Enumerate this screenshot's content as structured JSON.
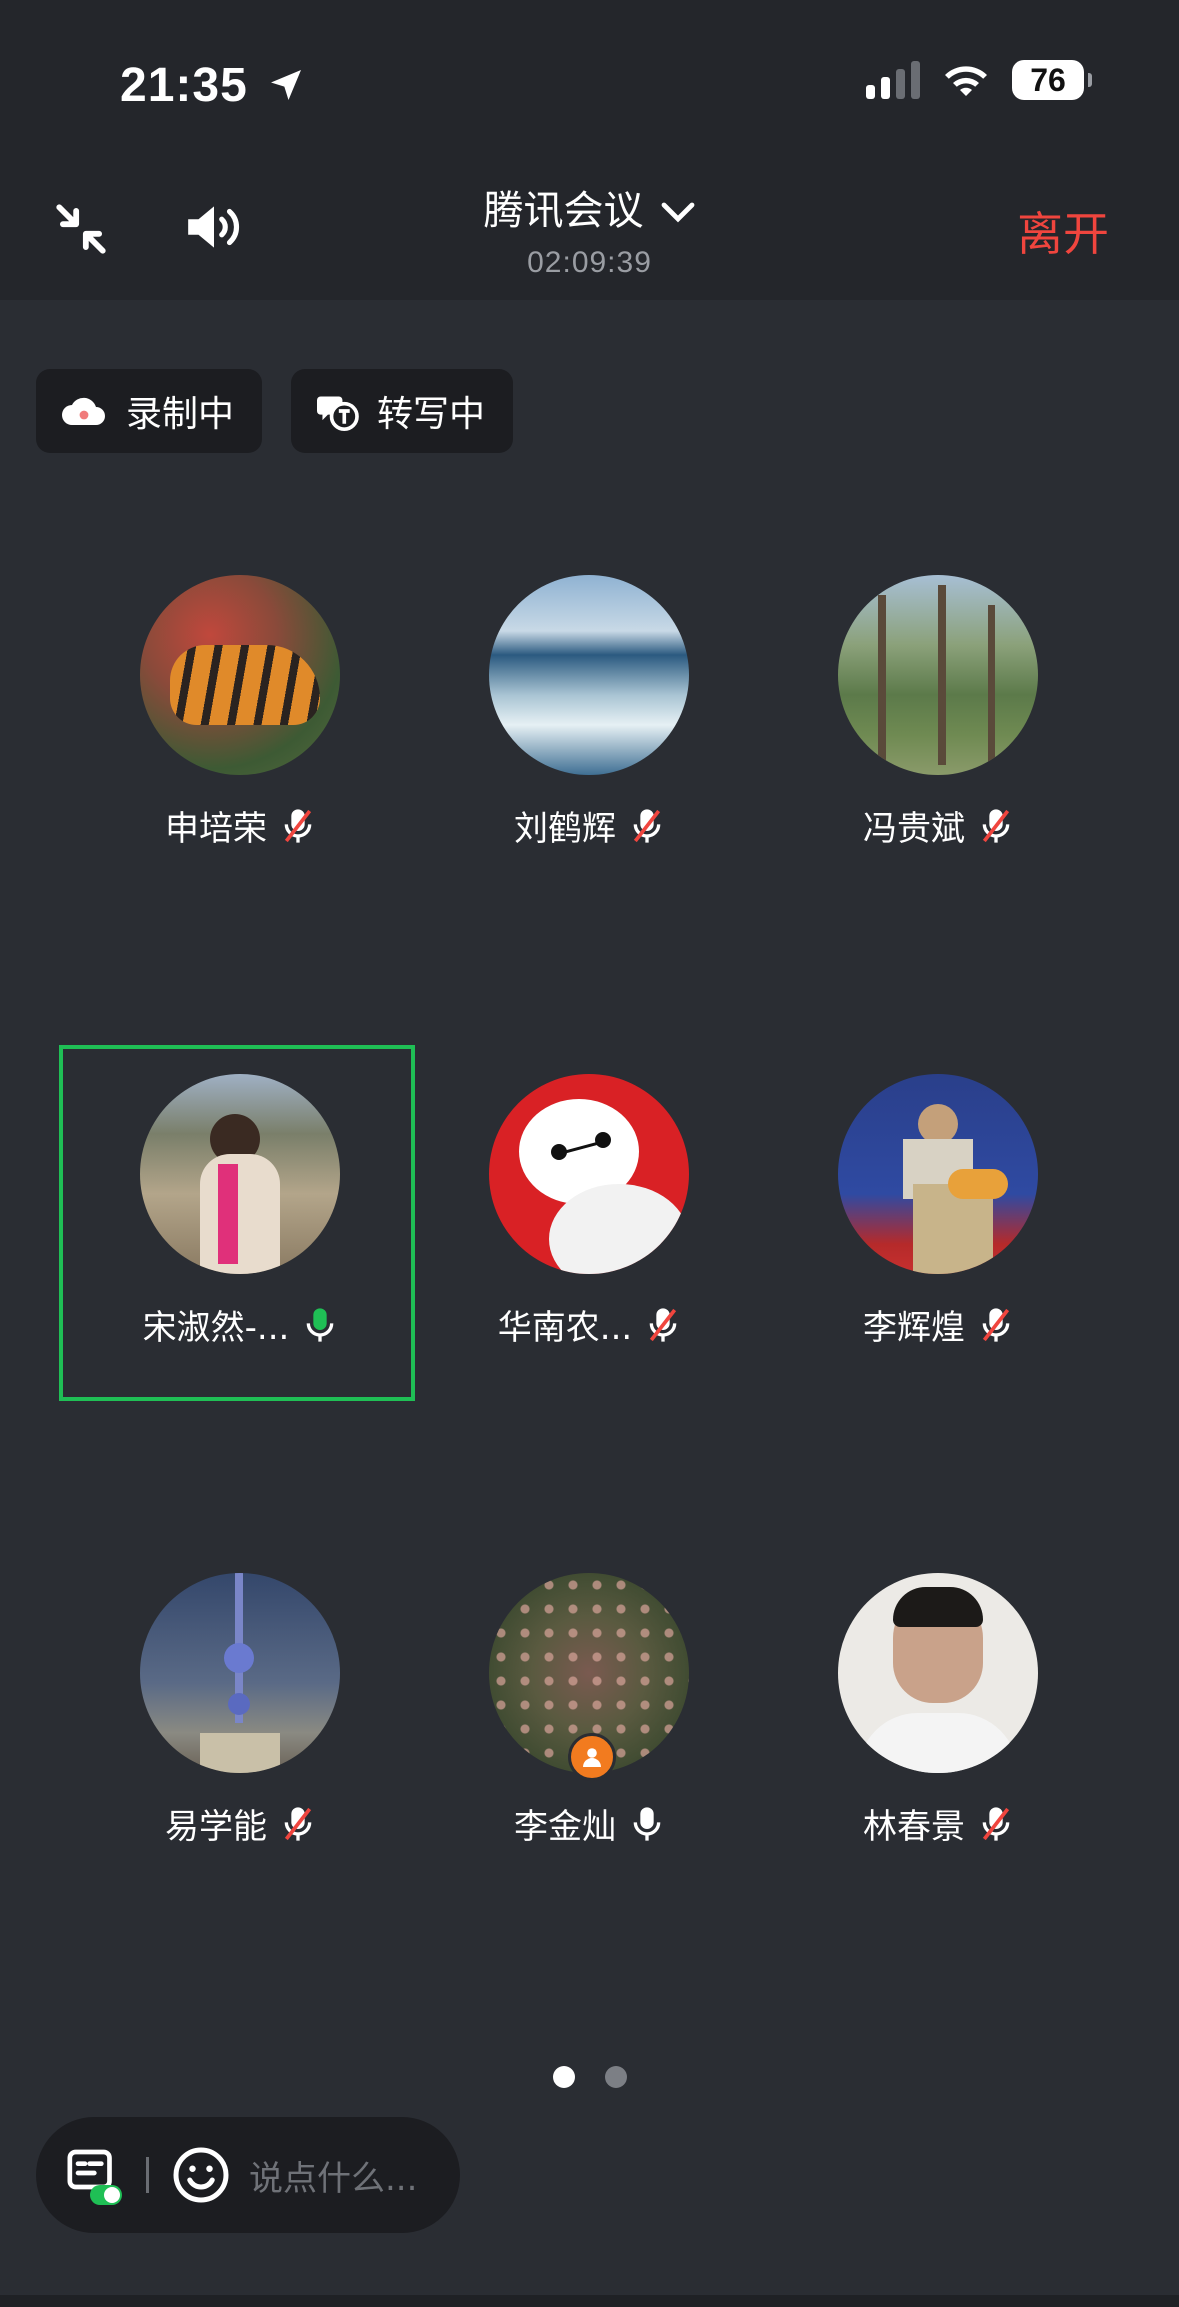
{
  "status_bar": {
    "time": "21:35",
    "battery": "76"
  },
  "header": {
    "title": "腾讯会议",
    "duration": "02:09:39",
    "leave_label": "离开"
  },
  "badges": {
    "recording": "录制中",
    "transcribing": "转写中"
  },
  "participants": [
    {
      "name": "申培荣",
      "mic": "muted"
    },
    {
      "name": "刘鹤辉",
      "mic": "muted"
    },
    {
      "name": "冯贵斌",
      "mic": "muted"
    },
    {
      "name": "宋淑然-...",
      "mic": "speaking"
    },
    {
      "name": "华南农...",
      "mic": "muted"
    },
    {
      "name": "李辉煌",
      "mic": "muted"
    },
    {
      "name": "易学能",
      "mic": "muted"
    },
    {
      "name": "李金灿",
      "mic": "on",
      "role": "host"
    },
    {
      "name": "林春景",
      "mic": "muted"
    }
  ],
  "pagination": {
    "pages": 2,
    "current": 1
  },
  "chat": {
    "placeholder": "说点什么..."
  },
  "colors": {
    "leave": "#f0453e",
    "speaking": "#1fbf55",
    "host_badge": "#f27b1f"
  }
}
